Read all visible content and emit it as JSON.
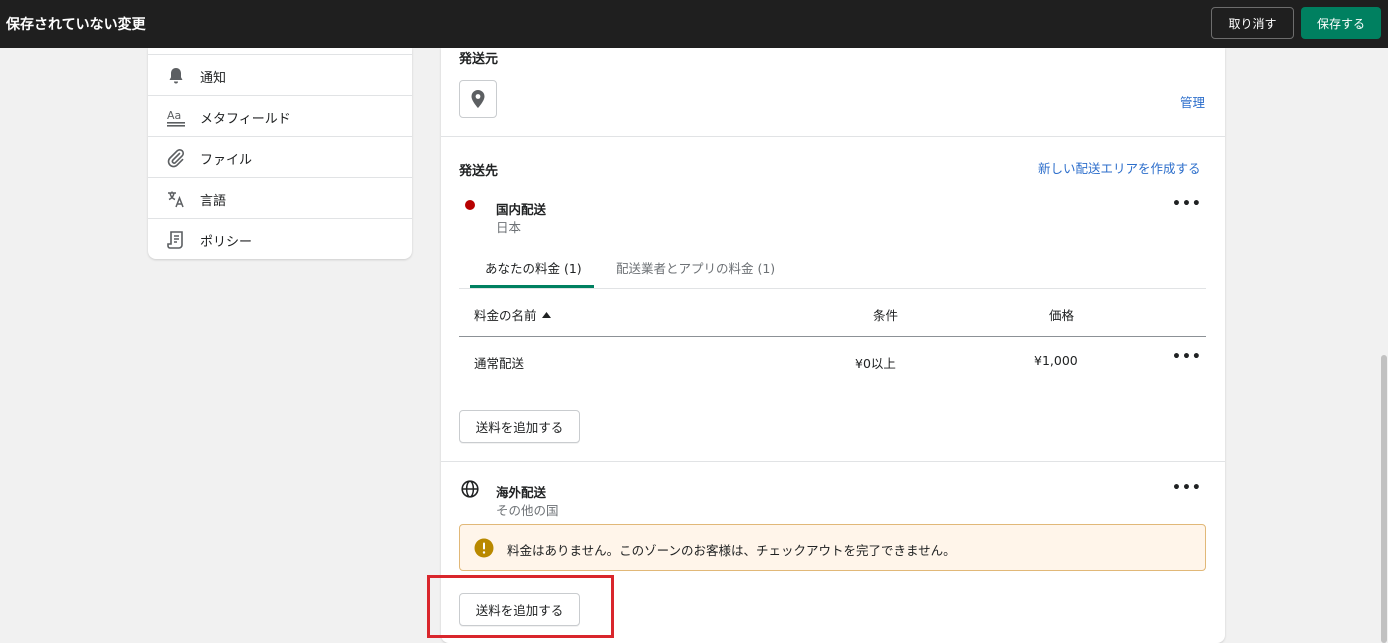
{
  "topbar": {
    "title": "保存されていない変更",
    "discard_label": "取り消す",
    "save_label": "保存する"
  },
  "sidebar": {
    "items": [
      {
        "label": "通知",
        "icon": "bell-icon"
      },
      {
        "label": "メタフィールド",
        "icon": "metafield-icon"
      },
      {
        "label": "ファイル",
        "icon": "paperclip-icon"
      },
      {
        "label": "言語",
        "icon": "translate-icon"
      },
      {
        "label": "ポリシー",
        "icon": "policy-icon"
      }
    ]
  },
  "origin": {
    "heading": "発送元",
    "manage_link": "管理"
  },
  "destination": {
    "heading": "発送先",
    "create_zone_link": "新しい配送エリアを作成する"
  },
  "domestic_zone": {
    "name": "国内配送",
    "countries": "日本",
    "status_color": "#b70000",
    "tabs": [
      {
        "label": "あなたの料金 (1)",
        "active": true
      },
      {
        "label": "配送業者とアプリの料金 (1)",
        "active": false
      }
    ],
    "table": {
      "headers": [
        "料金の名前",
        "条件",
        "価格"
      ],
      "rows": [
        {
          "name": "通常配送",
          "condition": "¥0以上",
          "price": "¥1,000"
        }
      ]
    },
    "add_rate_label": "送料を追加する"
  },
  "international_zone": {
    "name": "海外配送",
    "countries": "その他の国",
    "warning": "料金はありません。このゾーンのお客様は、チェックアウトを完了できません。",
    "add_rate_label": "送料を追加する"
  },
  "colors": {
    "accent": "#008060",
    "link": "#2c6ecb",
    "warning_bg": "#fff5ea",
    "warning_icon": "#b98900",
    "highlight": "#d9262c"
  }
}
